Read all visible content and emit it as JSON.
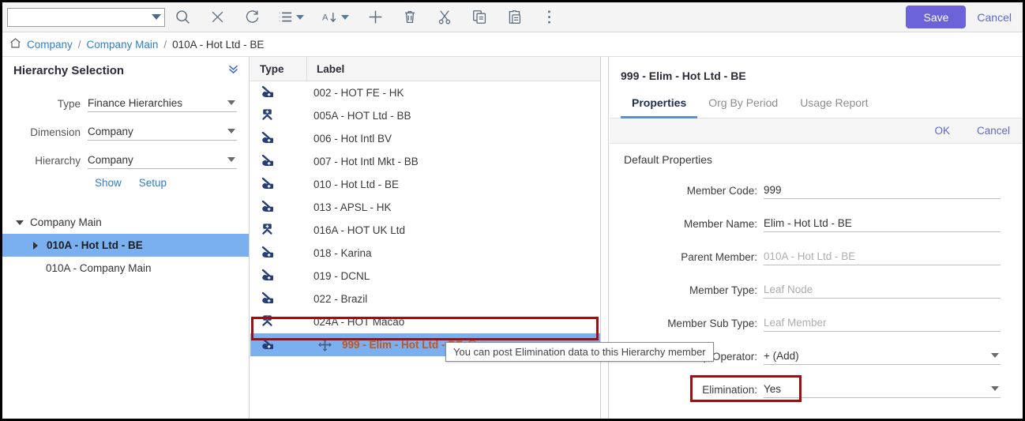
{
  "toolbar": {
    "search_value": "",
    "search_placeholder": "",
    "icons": [
      {
        "name": "search-icon",
        "title": "Search"
      },
      {
        "name": "close-icon",
        "title": "Clear"
      },
      {
        "name": "refresh-icon",
        "title": "Refresh"
      },
      {
        "name": "list-view-icon",
        "title": "List View"
      },
      {
        "name": "sort-icon",
        "title": "Sort"
      },
      {
        "name": "add-icon",
        "title": "Add"
      },
      {
        "name": "delete-icon",
        "title": "Delete"
      },
      {
        "name": "cut-icon",
        "title": "Cut"
      },
      {
        "name": "copy-icon",
        "title": "Copy"
      },
      {
        "name": "paste-icon",
        "title": "Paste"
      },
      {
        "name": "more-options-icon",
        "title": "More"
      }
    ],
    "save_label": "Save",
    "cancel_label": "Cancel",
    "save_color": "#6c63d8",
    "link_color": "#5b6ac9"
  },
  "breadcrumb": {
    "home_icon": "home-icon",
    "items": [
      {
        "label": "Company",
        "link": true
      },
      {
        "label": "Company Main",
        "link": true
      },
      {
        "label": "010A - Hot Ltd - BE",
        "link": false
      }
    ],
    "separator": "/"
  },
  "sidebar": {
    "title": "Hierarchy Selection",
    "collapse_icon": "double-chevron-down-icon",
    "fields": [
      {
        "label": "Type",
        "value": "Finance Hierarchies"
      },
      {
        "label": "Dimension",
        "value": "Company"
      },
      {
        "label": "Hierarchy",
        "value": "Company"
      }
    ],
    "links": [
      {
        "label": "Show"
      },
      {
        "label": "Setup"
      }
    ],
    "tree": [
      {
        "label": "Company Main",
        "indent": 0,
        "twisty": "down",
        "selected": false
      },
      {
        "label": "010A - Hot Ltd - BE",
        "indent": 1,
        "twisty": "right",
        "selected": true
      },
      {
        "label": "010A - Company Main",
        "indent": 2,
        "twisty": "none",
        "selected": false
      }
    ],
    "selection_color": "#7ab0f0"
  },
  "grid": {
    "columns": [
      "Type",
      "Label"
    ],
    "rows": [
      {
        "type_icon": "leaf-node-icon",
        "label": "002 - HOT FE - HK",
        "selected": false
      },
      {
        "type_icon": "parent-node-icon",
        "label": "005A - HOT Ltd - BB",
        "selected": false
      },
      {
        "type_icon": "leaf-node-icon",
        "label": "006 - Hot Intl BV",
        "selected": false
      },
      {
        "type_icon": "leaf-node-icon",
        "label": "007 - Hot Intl Mkt - BB",
        "selected": false
      },
      {
        "type_icon": "leaf-node-icon",
        "label": "010 - Hot Ltd - BE",
        "selected": false
      },
      {
        "type_icon": "leaf-node-icon",
        "label": "013 - APSL - HK",
        "selected": false
      },
      {
        "type_icon": "parent-node-icon",
        "label": "016A - HOT UK Ltd",
        "selected": false
      },
      {
        "type_icon": "leaf-node-icon",
        "label": "018 - Karina",
        "selected": false
      },
      {
        "type_icon": "leaf-node-icon",
        "label": "019 - DCNL",
        "selected": false
      },
      {
        "type_icon": "leaf-node-icon",
        "label": "022 - Brazil",
        "selected": false
      },
      {
        "type_icon": "parent-node-icon",
        "label": "024A - HOT Macao",
        "selected": false
      },
      {
        "type_icon": "leaf-node-icon",
        "label": "999 - Elim - Hot Ltd - BE",
        "selected": true,
        "move_icon": "move-handle-icon",
        "info_icon": "info-icon"
      }
    ],
    "selected_text_color": "#c4561b",
    "selection_color": "#7ab0f0"
  },
  "tooltip": {
    "text": "You can post Elimination data to this Hierarchy member"
  },
  "details": {
    "title": "999 - Elim - Hot Ltd - BE",
    "tabs": [
      {
        "label": "Properties",
        "active": true
      },
      {
        "label": "Org By Period",
        "active": false
      },
      {
        "label": "Usage Report",
        "active": false
      }
    ],
    "actions": {
      "ok_label": "OK",
      "cancel_label": "Cancel"
    },
    "section_title": "Default Properties",
    "properties": [
      {
        "label": "Member Code:",
        "value": "999",
        "disabled": false,
        "dropdown": false
      },
      {
        "label": "Member Name:",
        "value": "Elim - Hot Ltd - BE",
        "disabled": false,
        "dropdown": false
      },
      {
        "label": "Parent Member:",
        "value": "010A - Hot Ltd - BE",
        "disabled": true,
        "dropdown": false
      },
      {
        "label": "Member Type:",
        "value": "Leaf Node",
        "disabled": true,
        "dropdown": false
      },
      {
        "label": "Member Sub Type:",
        "value": "Leaf Member",
        "disabled": true,
        "dropdown": false
      },
      {
        "label": "Rollup Operator:",
        "value": "+ (Add)",
        "disabled": false,
        "dropdown": true
      },
      {
        "label": "Elimination:",
        "value": "Yes",
        "disabled": false,
        "dropdown": true
      }
    ]
  },
  "highlights": {
    "color": "#9e1010",
    "boxes": [
      "selected-grid-row",
      "elimination-field"
    ]
  }
}
